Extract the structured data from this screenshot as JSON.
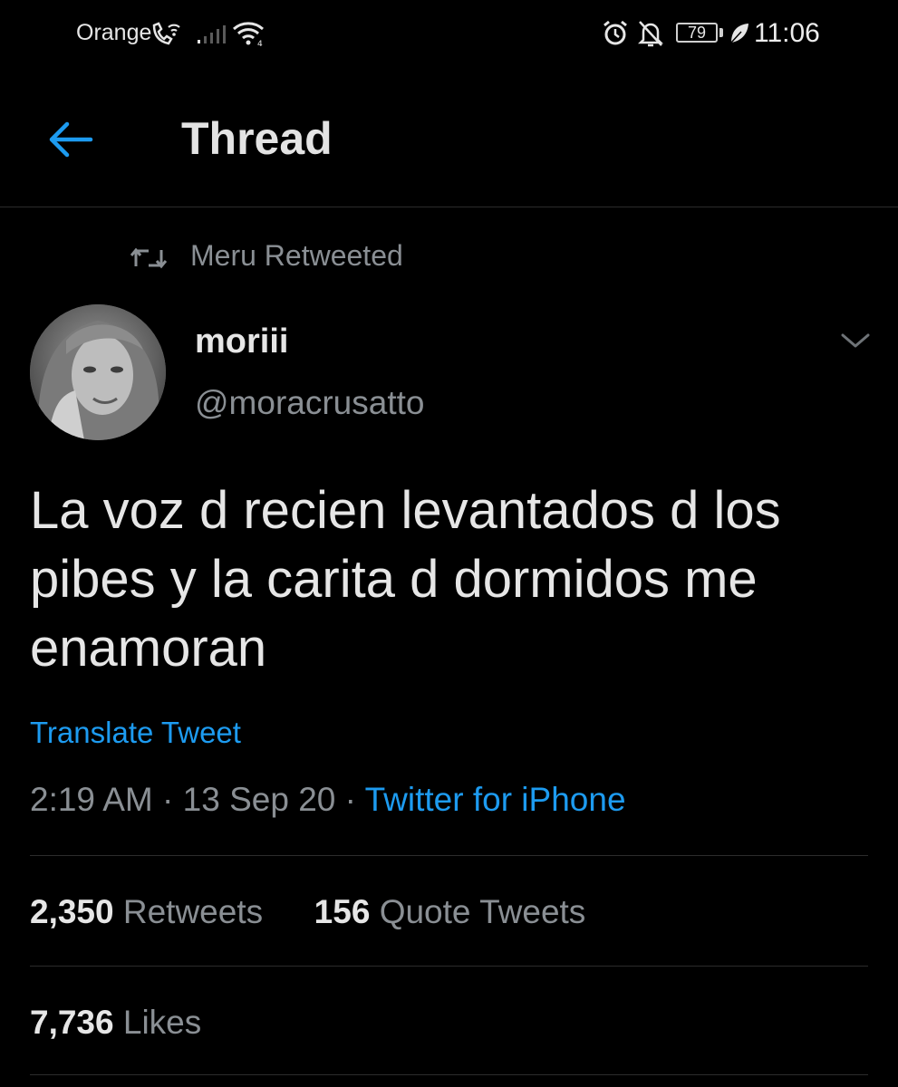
{
  "status_bar": {
    "carrier": "Orange",
    "battery": "79",
    "time": "11:06",
    "icons": [
      "wifi-calling-icon",
      "signal-icon",
      "wifi-icon",
      "alarm-icon",
      "bell-off-icon",
      "battery-icon",
      "leaf-icon"
    ]
  },
  "header": {
    "back_icon": "arrow-left-icon",
    "title": "Thread"
  },
  "tweet": {
    "retweeted_by": "Meru Retweeted",
    "author": {
      "display_name": "moriii",
      "handle": "@moracrusatto"
    },
    "text_lines": [
      "La voz d recien levantados d los",
      "pibes y la carita d dormidos me",
      "enamoran"
    ],
    "translate_label": "Translate Tweet",
    "time": "2:19 AM",
    "date": "13 Sep 20",
    "separator": "·",
    "source": "Twitter for iPhone",
    "stats": {
      "retweets_count": "2,350",
      "retweets_label": "Retweets",
      "quotes_count": "156",
      "quotes_label": "Quote Tweets",
      "likes_count": "7,736",
      "likes_label": "Likes"
    }
  },
  "colors": {
    "background": "#000000",
    "accent": "#1d9bf0",
    "secondary_text": "#8a8f94",
    "primary_text": "#e6e6e6"
  }
}
